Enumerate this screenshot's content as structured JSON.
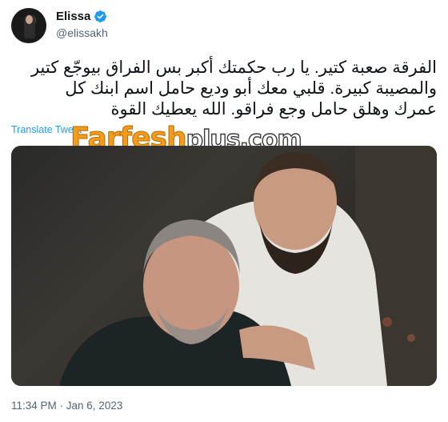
{
  "author": {
    "name": "Elissa",
    "handle": "@elissakh",
    "verified": true,
    "avatar_icon": "profile-avatar"
  },
  "tweet": {
    "lines": [
      "الفرقة صعبة كتير. يا رب حكمتك أكبر بس الفراق بيوجّع كتير",
      "والمصيبة كبيرة. قلبي معك أبو وديع حامل اسم ابنك كل",
      "عمرك وهلق حامل وجع فراقو. الله يعطيك القوة"
    ]
  },
  "translate_label": "Translate Tweet",
  "watermark": {
    "part1": "Farfesh",
    "part2": "plus.com"
  },
  "timestamp": "11:34 PM · Jan 6, 2023",
  "colors": {
    "link": "#1d9bf0",
    "secondary": "#536471",
    "verified": "#1d9bf0"
  }
}
